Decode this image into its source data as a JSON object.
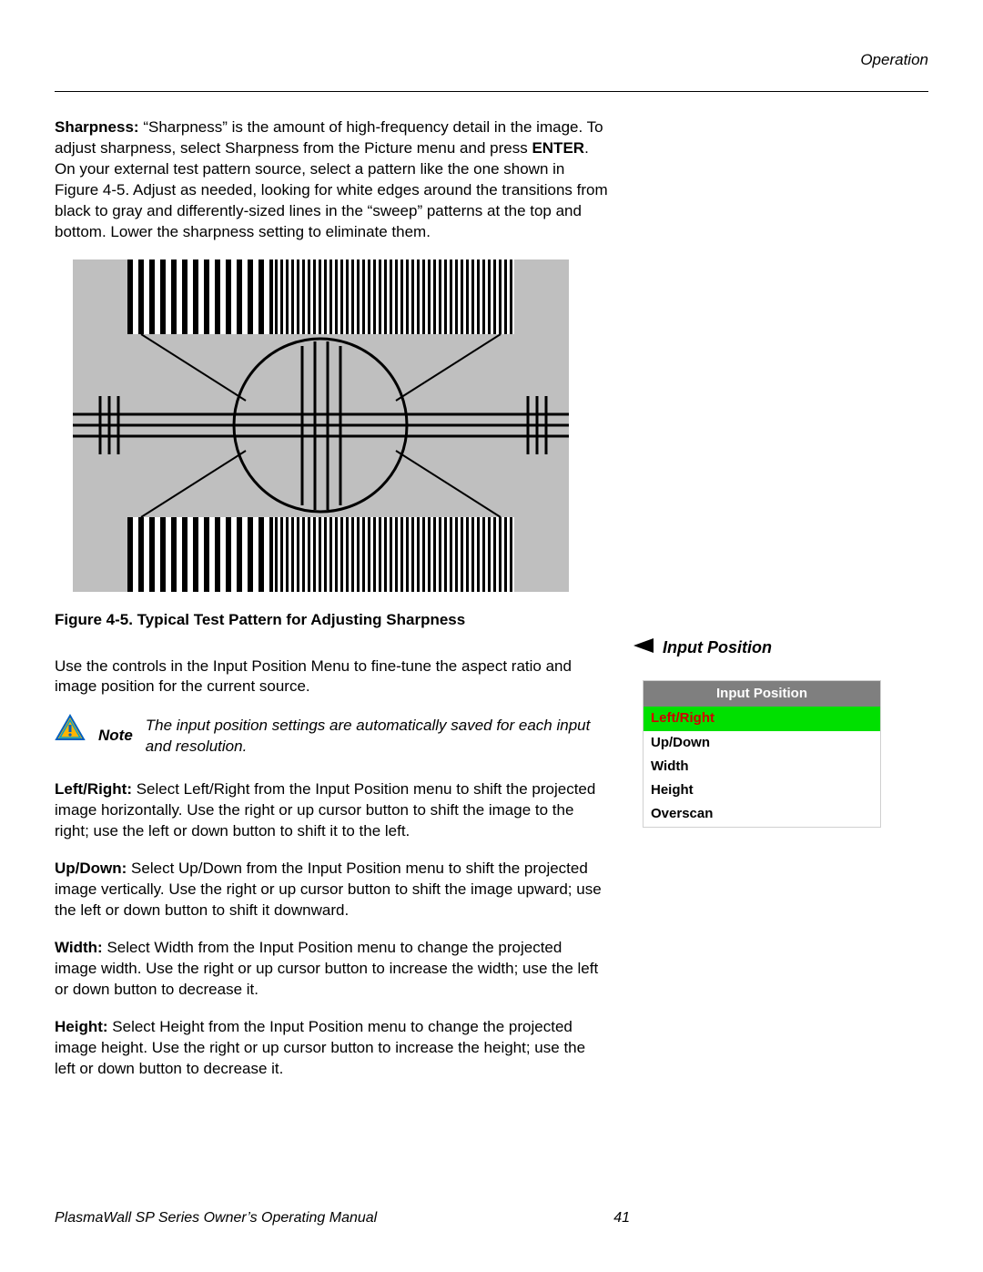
{
  "header": {
    "section": "Operation"
  },
  "sharpness": {
    "label": "Sharpness:",
    "text_before": " “Sharpness” is the amount of high-frequency detail in the image. To adjust sharpness, select Sharpness from the Picture menu and press ",
    "enter_label": "ENTER",
    "text_after": ". On your external test pattern source, select a pattern like the one shown in Figure 4-5. Adjust as needed, looking for white edges around the transitions from black to gray and differently-sized lines in the “sweep” patterns at the top and bottom. Lower the sharpness setting to eliminate them."
  },
  "figure_caption": "Figure 4-5. Typical Test Pattern for Adjusting Sharpness",
  "input_position_intro": "Use the controls in the Input Position Menu to fine-tune the aspect ratio and image position for the current source.",
  "note": {
    "label": "Note",
    "text": "The input position settings are automatically saved for each input and resolution."
  },
  "paragraphs": {
    "left_right": {
      "label": "Left/Right:",
      "text": " Select Left/Right from the Input Position menu to shift the projected image horizontally. Use the right or up cursor button to shift the image to the right; use the left or down button to shift it to the left."
    },
    "up_down": {
      "label": "Up/Down:",
      "text": " Select Up/Down from the Input Position menu to shift the projected image vertically. Use the right or up cursor button to shift the image upward; use the left or down button to shift it downward."
    },
    "width": {
      "label": "Width:",
      "text": " Select Width from the Input Position menu to change the projected image width. Use the right or up cursor button to increase the width; use the left or down button to decrease it."
    },
    "height": {
      "label": "Height:",
      "text": " Select Height from the Input Position menu to change the projected image height. Use the right or up cursor button to increase the height; use the left or down button to decrease it."
    }
  },
  "side": {
    "heading": "Input Position"
  },
  "menu": {
    "title": "Input Position",
    "selected": "Left/Right",
    "rows": [
      "Up/Down",
      "Width",
      "Height",
      "Overscan"
    ]
  },
  "footer": {
    "manual": "PlasmaWall SP Series Owner’s Operating Manual",
    "page_number": "41"
  }
}
